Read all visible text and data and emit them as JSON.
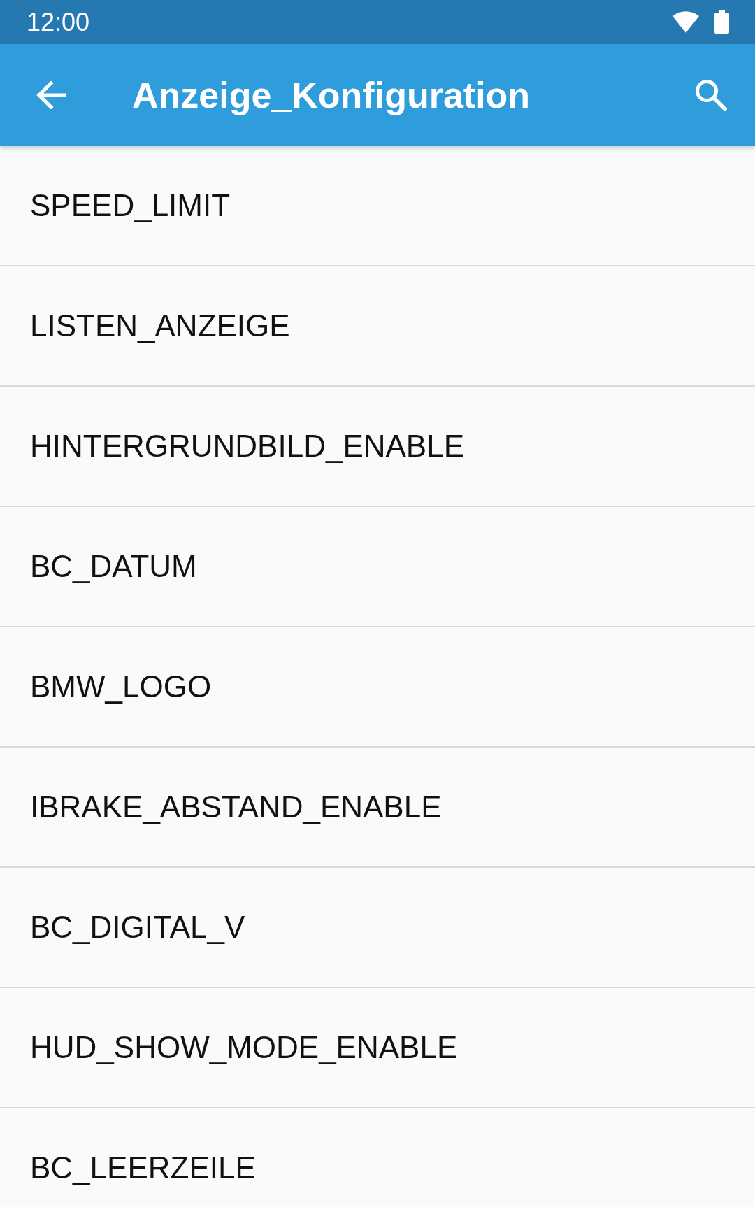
{
  "status_bar": {
    "time": "12:00"
  },
  "app_bar": {
    "title": "Anzeige_Konfiguration"
  },
  "items": [
    {
      "label": "SPEED_LIMIT"
    },
    {
      "label": "LISTEN_ANZEIGE"
    },
    {
      "label": "HINTERGRUNDBILD_ENABLE"
    },
    {
      "label": "BC_DATUM"
    },
    {
      "label": "BMW_LOGO"
    },
    {
      "label": "IBRAKE_ABSTAND_ENABLE"
    },
    {
      "label": "BC_DIGITAL_V"
    },
    {
      "label": "HUD_SHOW_MODE_ENABLE"
    },
    {
      "label": "BC_LEERZEILE"
    }
  ]
}
